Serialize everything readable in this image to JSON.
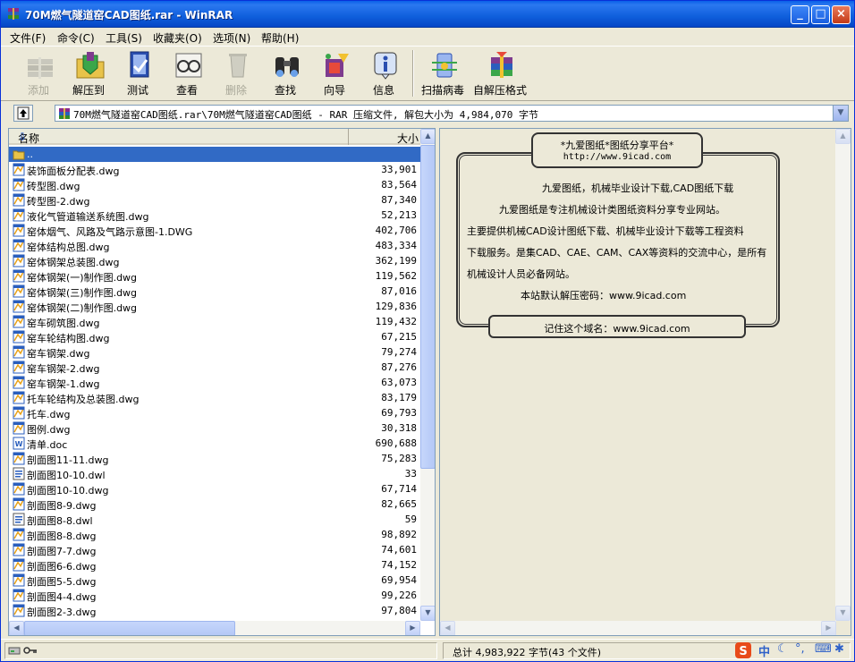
{
  "window": {
    "title": "70M燃气隧道窑CAD图纸.rar - WinRAR",
    "min_glyph": "_",
    "max_glyph": "□",
    "close_glyph": "×"
  },
  "menu": [
    {
      "label": "文件(F)"
    },
    {
      "label": "命令(C)"
    },
    {
      "label": "工具(S)"
    },
    {
      "label": "收藏夹(O)"
    },
    {
      "label": "选项(N)"
    },
    {
      "label": "帮助(H)"
    }
  ],
  "toolbar": {
    "tools": [
      {
        "label": "添加",
        "icon": "books-add-icon",
        "enabled": false
      },
      {
        "label": "解压到",
        "icon": "folder-extract-icon",
        "enabled": true
      },
      {
        "label": "测试",
        "icon": "test-icon",
        "enabled": true
      },
      {
        "label": "查看",
        "icon": "view-glasses-icon",
        "enabled": true
      },
      {
        "label": "删除",
        "icon": "delete-icon",
        "enabled": false
      },
      {
        "label": "查找",
        "icon": "binoculars-icon",
        "enabled": true
      },
      {
        "label": "向导",
        "icon": "wizard-icon",
        "enabled": true
      },
      {
        "label": "信息",
        "icon": "info-icon",
        "enabled": true
      },
      {
        "label": "扫描病毒",
        "icon": "virus-scan-icon",
        "enabled": true
      },
      {
        "label": "自解压格式",
        "icon": "sfx-icon",
        "enabled": true
      }
    ]
  },
  "address": {
    "path": "70M燃气隧道窑CAD图纸.rar\\70M燃气隧道窑CAD图纸 - RAR 压缩文件, 解包大小为 4,984,070 字节",
    "up_glyph": "⬆",
    "drop_glyph": "▼"
  },
  "filelist": {
    "col_name": "名称",
    "col_size": "大小",
    "sort_glyph": "⇩",
    "rows": [
      {
        "name": "..",
        "size": "",
        "type": "up",
        "selected": true
      },
      {
        "name": "装饰面板分配表.dwg",
        "size": "33,901",
        "type": "dwg"
      },
      {
        "name": "砖型图.dwg",
        "size": "83,564",
        "type": "dwg"
      },
      {
        "name": "砖型图-2.dwg",
        "size": "87,340",
        "type": "dwg"
      },
      {
        "name": "液化气管道输送系统图.dwg",
        "size": "52,213",
        "type": "dwg"
      },
      {
        "name": "窑体烟气、风路及气路示意图-1.DWG",
        "size": "402,706",
        "type": "dwg"
      },
      {
        "name": "窑体结构总图.dwg",
        "size": "483,334",
        "type": "dwg"
      },
      {
        "name": "窑体钢架总装图.dwg",
        "size": "362,199",
        "type": "dwg"
      },
      {
        "name": "窑体钢架(一)制作图.dwg",
        "size": "119,562",
        "type": "dwg"
      },
      {
        "name": "窑体钢架(三)制作图.dwg",
        "size": "87,016",
        "type": "dwg"
      },
      {
        "name": "窑体钢架(二)制作图.dwg",
        "size": "129,836",
        "type": "dwg"
      },
      {
        "name": "窑车砌筑图.dwg",
        "size": "119,432",
        "type": "dwg"
      },
      {
        "name": "窑车轮结构图.dwg",
        "size": "67,215",
        "type": "dwg"
      },
      {
        "name": "窑车钢架.dwg",
        "size": "79,274",
        "type": "dwg"
      },
      {
        "name": "窑车钢架-2.dwg",
        "size": "87,276",
        "type": "dwg"
      },
      {
        "name": "窑车钢架-1.dwg",
        "size": "63,073",
        "type": "dwg"
      },
      {
        "name": "托车轮结构及总装图.dwg",
        "size": "83,179",
        "type": "dwg"
      },
      {
        "name": "托车.dwg",
        "size": "69,793",
        "type": "dwg"
      },
      {
        "name": "图例.dwg",
        "size": "30,318",
        "type": "dwg"
      },
      {
        "name": "清单.doc",
        "size": "690,688",
        "type": "doc"
      },
      {
        "name": "剖面图11-11.dwg",
        "size": "75,283",
        "type": "dwg"
      },
      {
        "name": "剖面图10-10.dwl",
        "size": "33",
        "type": "dwl"
      },
      {
        "name": "剖面图10-10.dwg",
        "size": "67,714",
        "type": "dwg"
      },
      {
        "name": "剖面图8-9.dwg",
        "size": "82,665",
        "type": "dwg"
      },
      {
        "name": "剖面图8-8.dwl",
        "size": "59",
        "type": "dwl"
      },
      {
        "name": "剖面图8-8.dwg",
        "size": "98,892",
        "type": "dwg"
      },
      {
        "name": "剖面图7-7.dwg",
        "size": "74,601",
        "type": "dwg"
      },
      {
        "name": "剖面图6-6.dwg",
        "size": "74,152",
        "type": "dwg"
      },
      {
        "name": "剖面图5-5.dwg",
        "size": "69,954",
        "type": "dwg"
      },
      {
        "name": "剖面图4-4.dwg",
        "size": "99,226",
        "type": "dwg"
      },
      {
        "name": "剖面图2-3.dwg",
        "size": "97,804",
        "type": "dwg"
      }
    ]
  },
  "comment": {
    "top_line1": "*九爱图纸*图纸分享平台*",
    "top_line2": "http://www.9icad.com",
    "lines": [
      "九爱图纸，机械毕业设计下载,CAD图纸下载",
      "九爱图纸是专注机械设计类图纸资料分享专业网站。",
      "主要提供机械CAD设计图纸下载、机械毕业设计下载等工程资料",
      "下载服务。是集CAD、CAE、CAM、CAX等资料的交流中心，是所有",
      "机械设计人员必备网站。",
      "本站默认解压密码：www.9icad.com"
    ],
    "bottom": "记住这个域名：www.9icad.com"
  },
  "status": {
    "total": "总计 4,983,922 字节(43 个文件)",
    "ime_label": "中"
  },
  "colors": {
    "titlebar": "#0a5fe8",
    "selection": "#316ac5",
    "face": "#ece9d8"
  }
}
